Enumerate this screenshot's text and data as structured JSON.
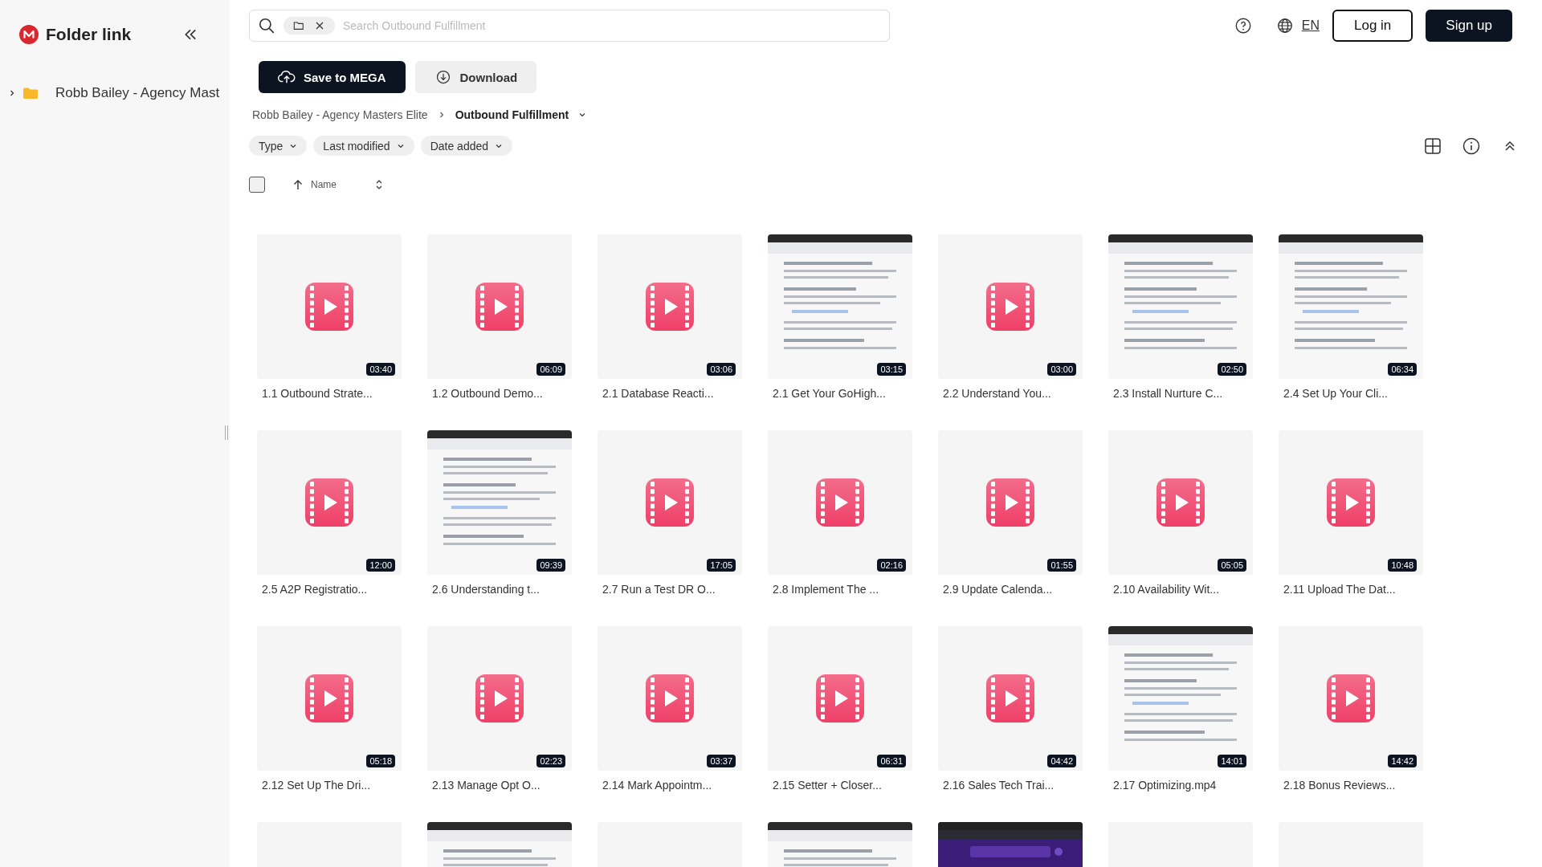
{
  "sidebar": {
    "title": "Folder link",
    "items": [
      {
        "label": "Robb Bailey - Agency Mast",
        "expanded": false
      }
    ]
  },
  "search": {
    "placeholder": "Search Outbound Fulfillment"
  },
  "header": {
    "language": "EN",
    "login": "Log in",
    "signup": "Sign up"
  },
  "actions": [
    "Save to MEGA",
    "Download"
  ],
  "breadcrumb": [
    {
      "label": "Robb Bailey - Agency Masters Elite",
      "selected": false
    },
    {
      "label": "Outbound Fulfillment",
      "selected": true
    }
  ],
  "filters": [
    "Type",
    "Last modified",
    "Date added"
  ],
  "sort": {
    "label": "Name",
    "checked": false
  },
  "files": [
    {
      "name": "1.1 Outbound Strate...",
      "duration": "03:40",
      "kind": "video"
    },
    {
      "name": "1.2 Outbound Demo...",
      "duration": "06:09",
      "kind": "video"
    },
    {
      "name": "2.1 Database Reacti...",
      "duration": "03:06",
      "kind": "video"
    },
    {
      "name": "2.1 Get Your GoHigh...",
      "duration": "03:15",
      "kind": "preview"
    },
    {
      "name": "2.2 Understand You...",
      "duration": "03:00",
      "kind": "video"
    },
    {
      "name": "2.3 Install Nurture C...",
      "duration": "02:50",
      "kind": "preview"
    },
    {
      "name": "2.4 Set Up Your Cli...",
      "duration": "06:34",
      "kind": "preview"
    },
    {
      "name": "2.5 A2P Registratio...",
      "duration": "12:00",
      "kind": "video"
    },
    {
      "name": "2.6 Understanding t...",
      "duration": "09:39",
      "kind": "preview"
    },
    {
      "name": "2.7 Run a Test DR O...",
      "duration": "17:05",
      "kind": "video"
    },
    {
      "name": "2.8 Implement The ...",
      "duration": "02:16",
      "kind": "video"
    },
    {
      "name": "2.9 Update Calenda...",
      "duration": "01:55",
      "kind": "video"
    },
    {
      "name": "2.10 Availability Wit...",
      "duration": "05:05",
      "kind": "video"
    },
    {
      "name": "2.11 Upload The Dat...",
      "duration": "10:48",
      "kind": "video"
    },
    {
      "name": "2.12 Set Up The Dri...",
      "duration": "05:18",
      "kind": "video"
    },
    {
      "name": "2.13 Manage Opt O...",
      "duration": "02:23",
      "kind": "video"
    },
    {
      "name": "2.14 Mark Appointm...",
      "duration": "03:37",
      "kind": "video"
    },
    {
      "name": "2.15 Setter + Closer...",
      "duration": "06:31",
      "kind": "video"
    },
    {
      "name": "2.16 Sales Tech Trai...",
      "duration": "04:42",
      "kind": "video"
    },
    {
      "name": "2.17 Optimizing.mp4",
      "duration": "14:01",
      "kind": "preview"
    },
    {
      "name": "2.18 Bonus Reviews...",
      "duration": "14:42",
      "kind": "video"
    },
    {
      "kind": "blank"
    },
    {
      "kind": "preview"
    },
    {
      "kind": "blank"
    },
    {
      "kind": "preview"
    },
    {
      "kind": "preview-dark"
    },
    {
      "kind": "blank"
    },
    {
      "kind": "blank"
    }
  ]
}
